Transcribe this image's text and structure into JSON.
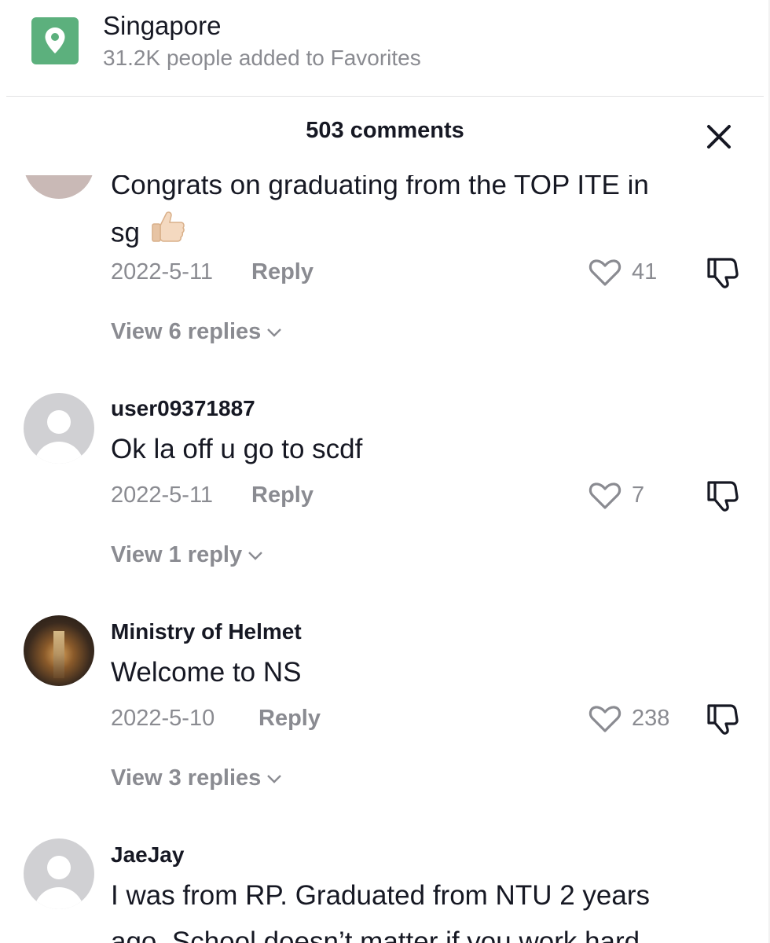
{
  "location": {
    "icon": "map-pin-icon",
    "title": "Singapore",
    "subtitle": "31.2K people added to Favorites",
    "icon_color": "#5cb07d"
  },
  "header": {
    "title": "503 comments",
    "close_icon": "close-icon"
  },
  "comments": [
    {
      "username": "",
      "text_line1": "Congrats on graduating from the TOP ITE in",
      "text_line2": "sg",
      "emoji": "thumbs-up-icon",
      "date": "2022-5-11",
      "reply_label": "Reply",
      "likes": "41",
      "view_replies": "View 6 replies",
      "avatar": "pink-avatar"
    },
    {
      "username": "user09371887",
      "text": "Ok la off u go to scdf",
      "date": "2022-5-11",
      "reply_label": "Reply",
      "likes": "7",
      "view_replies": "View 1 reply",
      "avatar": "default-avatar"
    },
    {
      "username": "Ministry of Helmet",
      "text": "Welcome to NS",
      "date": "2022-5-10",
      "reply_label": "Reply",
      "likes": "238",
      "view_replies": "View 3 replies",
      "avatar": "photo-avatar"
    },
    {
      "username": "JaeJay",
      "text_line1": "I was from RP. Graduated from NTU 2 years",
      "text_line2": "ago. School doesn’t matter if you work hard",
      "avatar": "default-avatar"
    }
  ],
  "colors": {
    "text_primary": "#161823",
    "text_secondary": "#8a8b91",
    "divider": "#e3e3e4"
  }
}
